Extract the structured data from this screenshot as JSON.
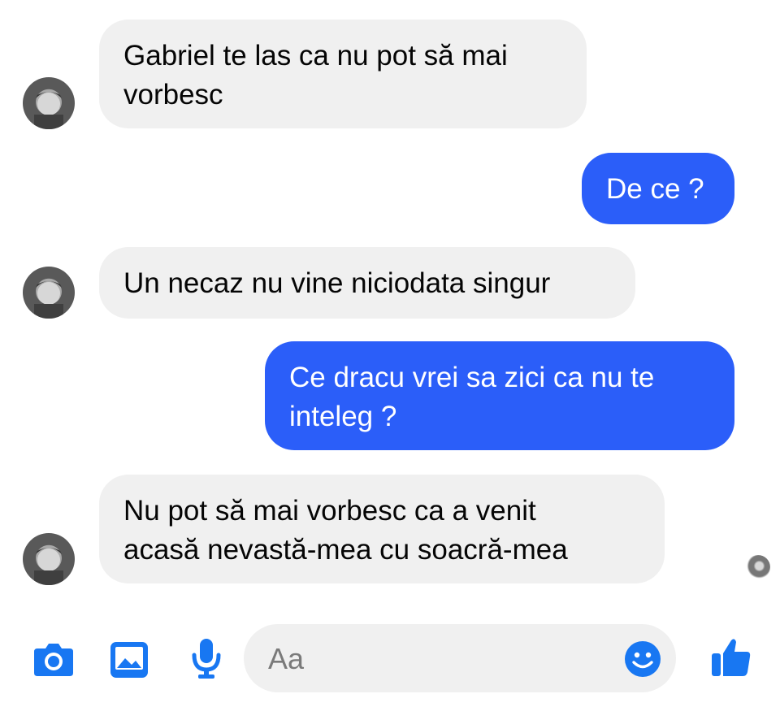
{
  "messages": [
    {
      "direction": "incoming",
      "text": "Gabriel te las ca nu pot să mai\nvorbesc"
    },
    {
      "direction": "outgoing",
      "text": "De ce ?"
    },
    {
      "direction": "incoming",
      "text": "Un necaz nu vine niciodata singur"
    },
    {
      "direction": "outgoing",
      "text": "Ce dracu vrei sa zici  ca nu te\ninteleg ?"
    },
    {
      "direction": "incoming",
      "text": "Nu pot să mai vorbesc ca a venit\nacasă nevastă-mea cu soacră-mea"
    }
  ],
  "composer": {
    "placeholder": "Aa"
  },
  "toolbar": {
    "icons": [
      "camera-icon",
      "image-icon",
      "microphone-icon",
      "emoji-icon",
      "thumbs-up-icon"
    ]
  },
  "colors": {
    "accent": "#2b5ef9",
    "incoming_bubble": "#f0f0f0",
    "icon": "#1877f2"
  }
}
